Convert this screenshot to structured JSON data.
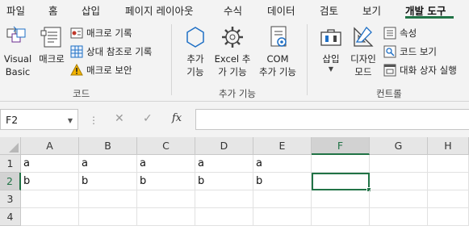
{
  "tabs": [
    "파일",
    "홈",
    "삽입",
    "페이지 레이아웃",
    "수식",
    "데이터",
    "검토",
    "보기",
    "개발 도구"
  ],
  "active_tab": "개발 도구",
  "ribbon": {
    "code": {
      "visual_basic": [
        "Visual",
        "Basic"
      ],
      "macros": "매크로",
      "record_macro": "매크로 기록",
      "relative_refs": "상대 참조로 기록",
      "macro_security": "매크로 보안",
      "label": "코드"
    },
    "addins": {
      "addins": [
        "추가",
        "기능"
      ],
      "excel_addins": [
        "Excel 추",
        "가 기능"
      ],
      "com_addins": [
        "COM",
        "추가 기능"
      ],
      "label": "추가 기능"
    },
    "controls": {
      "insert": "삽입",
      "design_mode": [
        "디자인",
        "모드"
      ],
      "properties": "속성",
      "view_code": "코드 보기",
      "run_dialog": "대화 상자 실행",
      "label": "컨트롤"
    }
  },
  "formula_bar": {
    "name_box": "F2",
    "cancel_glyph": "✕",
    "enter_glyph": "✓",
    "fx": "fx",
    "value": ""
  },
  "grid": {
    "columns": [
      "A",
      "B",
      "C",
      "D",
      "E",
      "F",
      "G",
      "H"
    ],
    "rows": [
      "1",
      "2",
      "3",
      "4"
    ],
    "selected_column": "F",
    "selected_row": "2",
    "cells": {
      "r1": [
        "a",
        "a",
        "a",
        "a",
        "a",
        "",
        "",
        ""
      ],
      "r2": [
        "b",
        "b",
        "b",
        "b",
        "b",
        "",
        "",
        ""
      ],
      "r3": [
        "",
        "",
        "",
        "",
        "",
        "",
        "",
        ""
      ],
      "r4": [
        "",
        "",
        "",
        "",
        "",
        "",
        "",
        ""
      ]
    }
  },
  "colors": {
    "accent": "#217346",
    "ribbon_bg": "#f3f3f3",
    "warning": "#f2b300"
  }
}
